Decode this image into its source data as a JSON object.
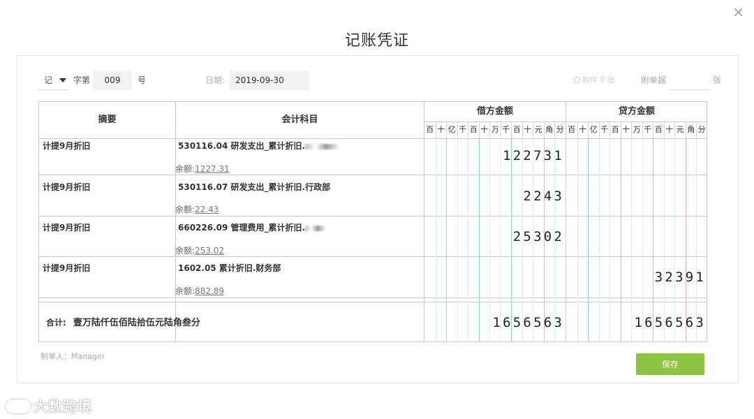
{
  "dialog": {
    "title": "记账凭证",
    "close_glyph": "×"
  },
  "header": {
    "voucher_type": "记",
    "zi_label": "字第",
    "number": "009",
    "hao_label": "号",
    "date_label": "日期:",
    "date": "2019-09-30",
    "attachment": "附件 0 张",
    "attached_docs_label": "附单据",
    "attached_docs_value": "",
    "zhang_label": "张"
  },
  "table": {
    "col_summary": "摘要",
    "col_subject": "会计科目",
    "col_debit": "借方金额",
    "col_credit": "贷方金额",
    "units": [
      "百",
      "十",
      "亿",
      "千",
      "百",
      "十",
      "万",
      "千",
      "百",
      "十",
      "元",
      "角",
      "分"
    ],
    "rows": [
      {
        "summary": "计提9月折旧",
        "subject": "530116.04 研发支出_累计折旧.",
        "subject_blurred": true,
        "balance_label": "余额:",
        "balance": "1227.31",
        "debit": "122731",
        "credit": ""
      },
      {
        "summary": "计提9月折旧",
        "subject": "530116.07 研发支出_累计折旧.行政部",
        "subject_blurred": false,
        "balance_label": "余额:",
        "balance": "22.43",
        "debit": "2243",
        "credit": ""
      },
      {
        "summary": "计提9月折旧",
        "subject": "660226.09 管理费用_累计折旧.",
        "subject_blurred": true,
        "balance_label": "余额:",
        "balance": "253.02",
        "debit": "25302",
        "credit": ""
      },
      {
        "summary": "计提9月折旧",
        "subject": "1602.05 累计折旧.财务部",
        "subject_blurred": false,
        "balance_label": "余额:",
        "balance": "882.89",
        "debit": "",
        "credit": "32391"
      }
    ],
    "total_label": "合计:",
    "total_text": "壹万陆仟伍佰陆拾伍元陆角叁分",
    "total_debit": "1656563",
    "total_credit": "1656563"
  },
  "footer": {
    "maker": "制单人：Manager",
    "save_label": "保存"
  },
  "watermark": {
    "text": "大数跨境"
  }
}
